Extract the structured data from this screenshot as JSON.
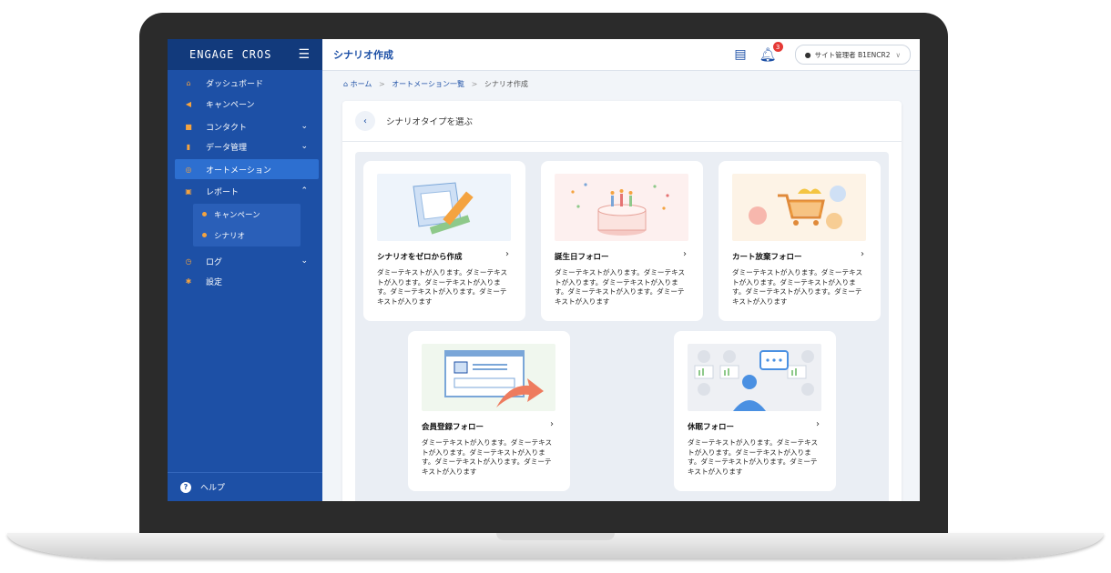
{
  "app": {
    "brand": "ENGAGE CROS",
    "page_title": "シナリオ作成"
  },
  "header": {
    "notification_count": "3",
    "user_label": "サイト管理者 B1ENCR2"
  },
  "sidebar": {
    "items": [
      {
        "label": "ダッシュボード",
        "icon": "home-icon"
      },
      {
        "label": "キャンペーン",
        "icon": "megaphone-icon"
      },
      {
        "label": "コンタクト",
        "icon": "contact-card-icon"
      },
      {
        "label": "データ管理",
        "icon": "bar-chart-icon"
      },
      {
        "label": "オートメーション",
        "icon": "automation-icon"
      },
      {
        "label": "レポート",
        "icon": "report-icon"
      },
      {
        "label": "ログ",
        "icon": "history-icon"
      },
      {
        "label": "設定",
        "icon": "gear-icon"
      }
    ],
    "report_sub": [
      {
        "label": "キャンペーン"
      },
      {
        "label": "シナリオ"
      }
    ],
    "help_label": "ヘルプ"
  },
  "breadcrumb": {
    "home": "ホーム",
    "mid": "オートメーション一覧",
    "current": "シナリオ作成"
  },
  "panel": {
    "title": "シナリオタイプを選ぶ"
  },
  "cards": [
    {
      "title": "シナリオをゼロから作成",
      "desc": "ダミーテキストが入ります。ダミーテキストが入ります。ダミーテキストが入ります。ダミーテキストが入ります。ダミーテキストが入ります"
    },
    {
      "title": "誕生日フォロー",
      "desc": "ダミーテキストが入ります。ダミーテキストが入ります。ダミーテキストが入ります。ダミーテキストが入ります。ダミーテキストが入ります"
    },
    {
      "title": "カート放棄フォロー",
      "desc": "ダミーテキストが入ります。ダミーテキストが入ります。ダミーテキストが入ります。ダミーテキストが入ります。ダミーテキストが入ります"
    },
    {
      "title": "会員登録フォロー",
      "desc": "ダミーテキストが入ります。ダミーテキストが入ります。ダミーテキストが入ります。ダミーテキストが入ります。ダミーテキストが入ります"
    },
    {
      "title": "休眠フォロー",
      "desc": "ダミーテキストが入ります。ダミーテキストが入ります。ダミーテキストが入ります。ダミーテキストが入ります。ダミーテキストが入ります"
    }
  ],
  "colors": {
    "sidebar": "#1d50a6",
    "accent": "#f4a340",
    "active": "#2d6fd0",
    "badge": "#e53935"
  }
}
